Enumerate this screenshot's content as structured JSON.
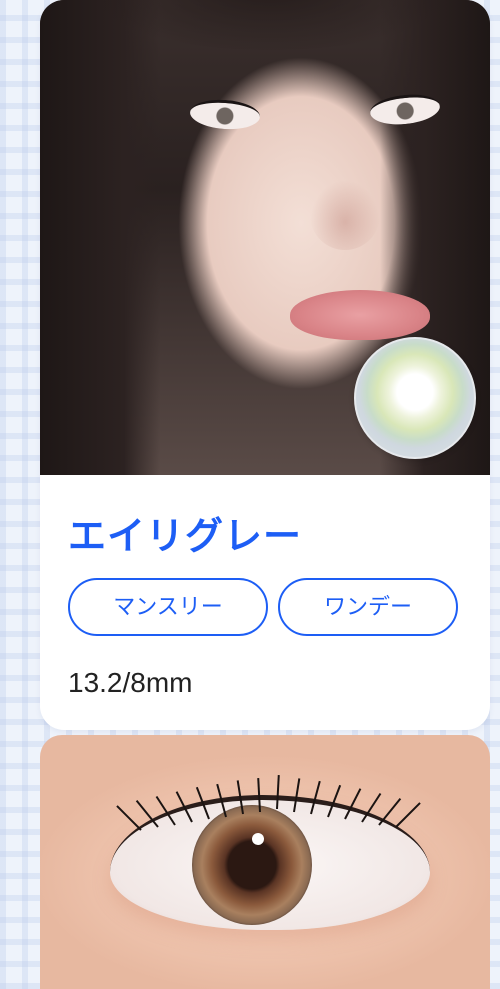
{
  "product": {
    "name": "エイリグレー",
    "tags": [
      "マンスリー",
      "ワンデー"
    ],
    "spec": "13.2/8mm"
  },
  "colors": {
    "accent": "#1d5ef5",
    "text": "#222222",
    "background": "#eef3fb"
  }
}
